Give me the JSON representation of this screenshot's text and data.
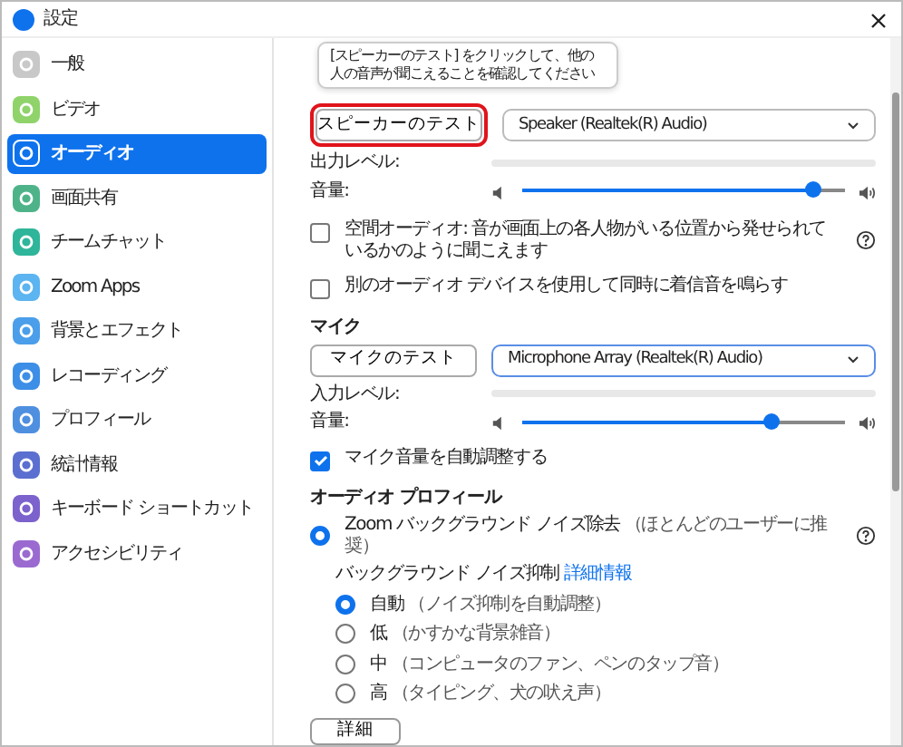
{
  "window": {
    "title": "設定"
  },
  "sidebar": {
    "items": [
      {
        "label": "一般",
        "selected": false,
        "color": "#c8c8c8"
      },
      {
        "label": "ビデオ",
        "selected": false,
        "color": "#8fd36a"
      },
      {
        "label": "オーディオ",
        "selected": true,
        "color": "#0e72ed"
      },
      {
        "label": "画面共有",
        "selected": false,
        "color": "#4fb38a"
      },
      {
        "label": "チームチャット",
        "selected": false,
        "color": "#2fb59a"
      },
      {
        "label": "Zoom Apps",
        "selected": false,
        "color": "#5cb4f0"
      },
      {
        "label": "背景とエフェクト",
        "selected": false,
        "color": "#4a9eea"
      },
      {
        "label": "レコーディング",
        "selected": false,
        "color": "#3d8ee6"
      },
      {
        "label": "プロフィール",
        "selected": false,
        "color": "#4f8fe0"
      },
      {
        "label": "統計情報",
        "selected": false,
        "color": "#5a6fd0"
      },
      {
        "label": "キーボード ショートカット",
        "selected": false,
        "color": "#7b62cc"
      },
      {
        "label": "アクセシビリティ",
        "selected": false,
        "color": "#9a6ad0"
      }
    ]
  },
  "tooltip": "[スピーカーのテスト] をクリックして、他の人の音声が聞こえることを確認してください",
  "speaker": {
    "test_button": "スピーカーのテスト",
    "highlighted": true,
    "device": "Speaker (Realtek(R) Audio)",
    "output_label": "出力レベル:",
    "volume_label": "音量:",
    "volume": {
      "level": 0.9
    }
  },
  "options": [
    {
      "label": "空間オーディオ: 音が画面上の各人物がいる位置から発せられているかのように聞こえます",
      "checked": false,
      "help": true
    },
    {
      "label": "別のオーディオ デバイスを使用して同時に着信音を鳴らす",
      "checked": false,
      "help": false
    }
  ],
  "microphone": {
    "heading": "マイク",
    "test_button": "マイクのテスト",
    "device": "Microphone Array (Realtek(R) Audio)",
    "input_label": "入力レベル:",
    "volume_label": "音量:",
    "volume": {
      "level": 0.77
    },
    "auto_adjust": {
      "label": "マイク音量を自動調整する",
      "checked": true
    }
  },
  "audio_profile": {
    "heading": "オーディオ プロフィール",
    "zoom_noise": {
      "label": "Zoom バックグラウンド ノイズ除去",
      "note": "（ほとんどのユーザーに推奨）",
      "selected": true
    },
    "suppression_label": "バックグラウンド ノイズ抑制",
    "more_link": "詳細情報",
    "levels": [
      {
        "label": "自動",
        "note": "（ノイズ抑制を自動調整）",
        "selected": true
      },
      {
        "label": "低",
        "note": "（かすかな背景雑音）",
        "selected": false
      },
      {
        "label": "中",
        "note": "（コンピュータのファン、ペンのタップ音）",
        "selected": false
      },
      {
        "label": "高",
        "note": "（タイピング、犬の吠え声）",
        "selected": false
      }
    ]
  },
  "advanced_button": "詳細"
}
